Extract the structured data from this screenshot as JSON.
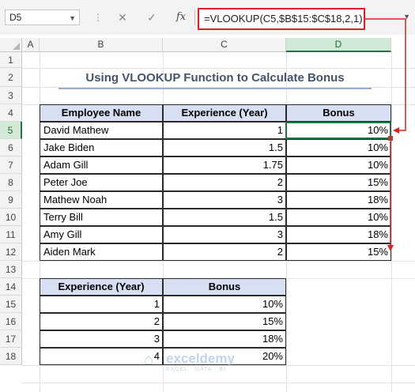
{
  "name_box": "D5",
  "formula_bar": {
    "cancel": "✕",
    "confirm": "✓",
    "fx": "fx",
    "formula": "=VLOOKUP(C5,$B$15:$C$18,2,1)"
  },
  "columns": [
    "A",
    "B",
    "C",
    "D"
  ],
  "rows": [
    "1",
    "2",
    "3",
    "4",
    "5",
    "6",
    "7",
    "8",
    "9",
    "10",
    "11",
    "12",
    "13",
    "14",
    "15",
    "16",
    "17",
    "18"
  ],
  "title": "Using VLOOKUP Function to Calculate Bonus",
  "main_table": {
    "headers": [
      "Employee Name",
      "Experience (Year)",
      "Bonus"
    ],
    "rows": [
      [
        "David Mathew",
        "1",
        "10%"
      ],
      [
        "Jake Biden",
        "1.5",
        "10%"
      ],
      [
        "Adam Gill",
        "1.75",
        "10%"
      ],
      [
        "Peter Joe",
        "2",
        "15%"
      ],
      [
        "Mathew Noah",
        "3",
        "18%"
      ],
      [
        "Terry Bill",
        "1.5",
        "10%"
      ],
      [
        "Amy Gill",
        "3",
        "18%"
      ],
      [
        "Aiden Mark",
        "2",
        "15%"
      ]
    ]
  },
  "lookup_table": {
    "headers": [
      "Experience (Year)",
      "Bonus"
    ],
    "rows": [
      [
        "1",
        "10%"
      ],
      [
        "2",
        "15%"
      ],
      [
        "3",
        "18%"
      ],
      [
        "4",
        "20%"
      ]
    ]
  },
  "watermark": {
    "name": "exceldemy",
    "tagline": "EXCEL · DATA · BI"
  },
  "colors": {
    "formula_highlight": "#e21f1f",
    "header_fill": "#d6e0f2",
    "title_text": "#44546a",
    "selection": "#217346"
  }
}
